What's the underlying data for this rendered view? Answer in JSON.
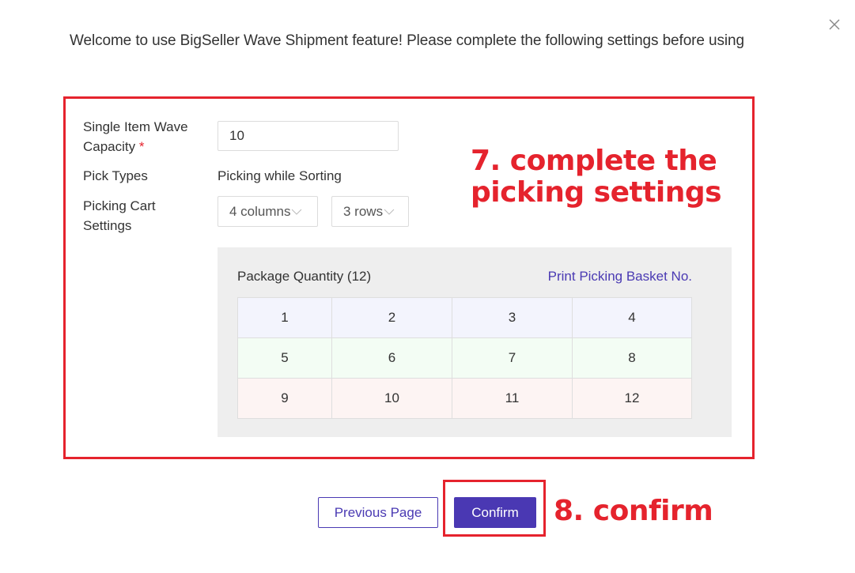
{
  "dialog": {
    "welcome_text": "Welcome to use BigSeller Wave Shipment feature! Please complete the following settings before using",
    "close_icon": "close-icon"
  },
  "form": {
    "capacity": {
      "label_line1": "Single Item Wave",
      "label_line2": "Capacity",
      "required_mark": "*",
      "value": "10"
    },
    "pick_types": {
      "label": "Pick Types",
      "value": "Picking while Sorting"
    },
    "picking_cart": {
      "label_line1": "Picking Cart",
      "label_line2": "Settings",
      "columns_selected": "4 columns",
      "rows_selected": "3 rows",
      "chevron_icon": "chevron-down-icon"
    }
  },
  "preview": {
    "package_quantity_label": "Package Quantity (12)",
    "print_link": "Print Picking Basket No.",
    "grid": [
      [
        "1",
        "2",
        "3",
        "4"
      ],
      [
        "5",
        "6",
        "7",
        "8"
      ],
      [
        "9",
        "10",
        "11",
        "12"
      ]
    ],
    "row_colors": [
      "#f3f4fd",
      "#f3fdf4",
      "#fdf4f3"
    ]
  },
  "footer": {
    "previous_label": "Previous Page",
    "confirm_label": "Confirm"
  },
  "annotations": {
    "step7_line1": "7. complete the",
    "step7_line2": "picking settings",
    "step8": "8. confirm",
    "color": "#e5232d"
  },
  "colors": {
    "primary": "#4a38b3",
    "annotation_red": "#e5232d",
    "panel_bg": "#eeeeee"
  }
}
